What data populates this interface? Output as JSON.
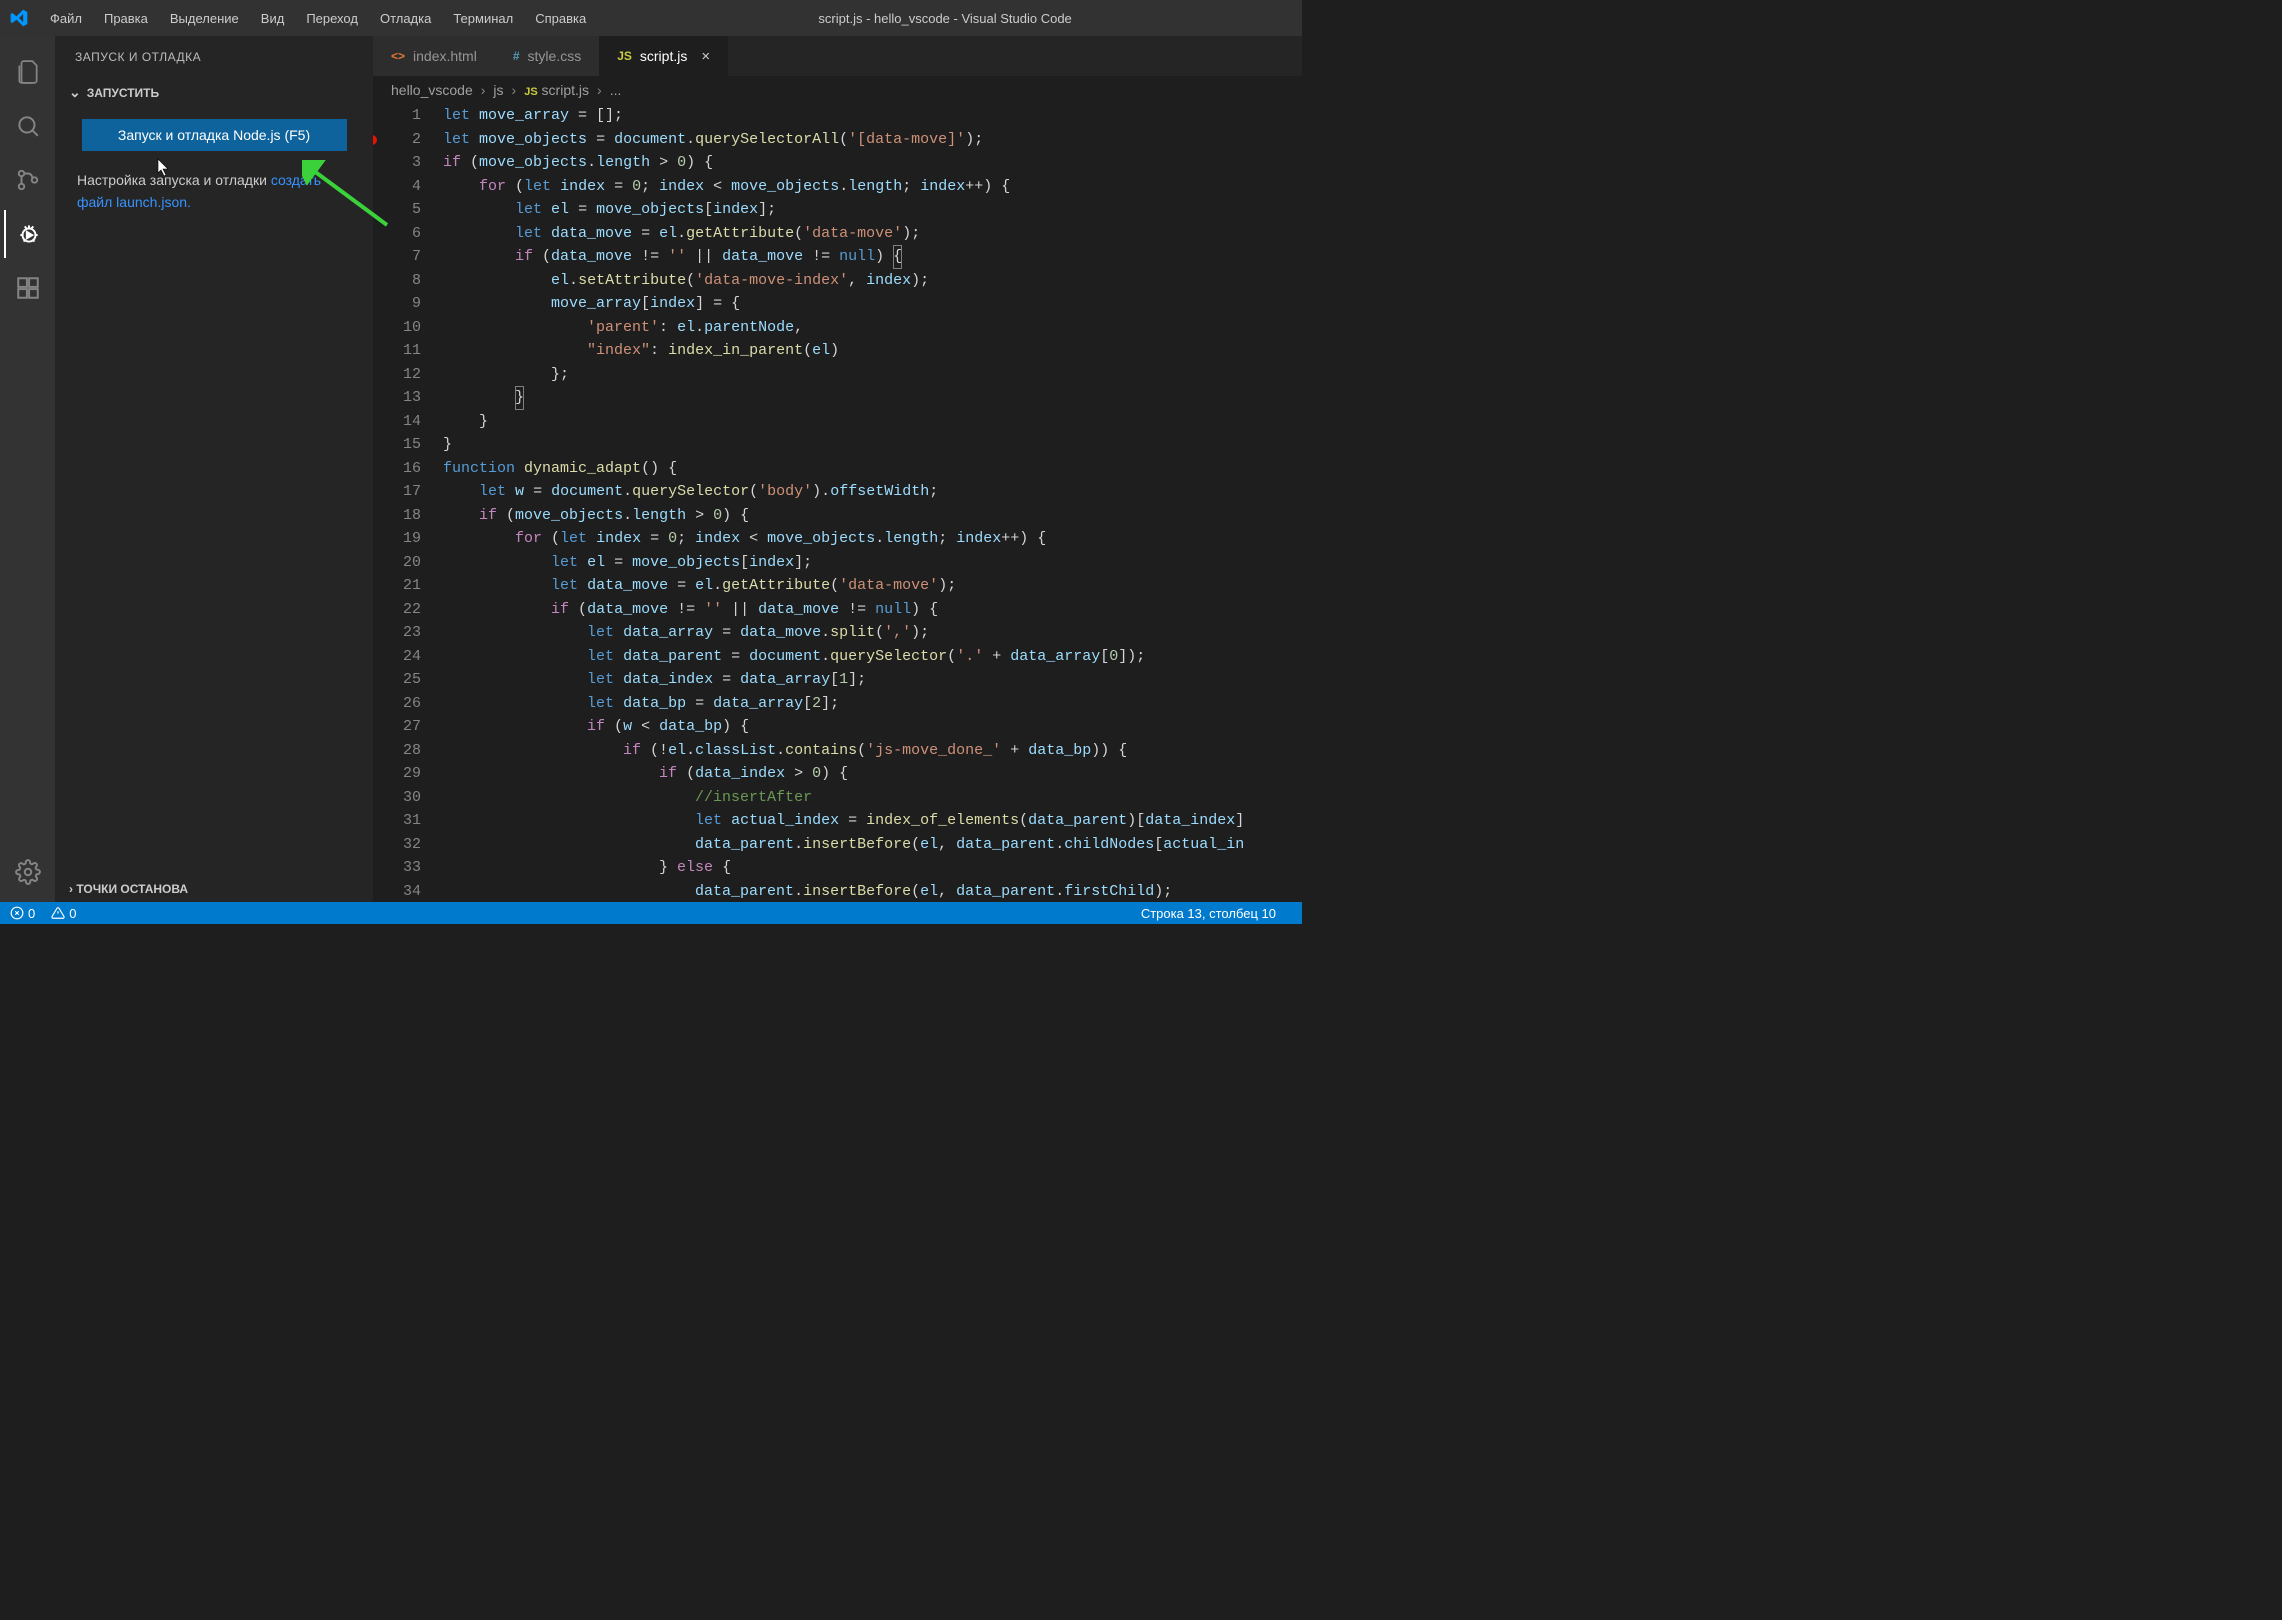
{
  "menubar": {
    "items": [
      "Файл",
      "Правка",
      "Выделение",
      "Вид",
      "Переход",
      "Отладка",
      "Терминал",
      "Справка"
    ],
    "title": "script.js - hello_vscode - Visual Studio Code"
  },
  "activity": {
    "items": [
      "files-icon",
      "search-icon",
      "source-control-icon",
      "debug-icon",
      "extensions-icon"
    ],
    "bottom": [
      "gear-icon"
    ],
    "active": 3
  },
  "sidebar": {
    "header": "ЗАПУСК И ОТЛАДКА",
    "section_run": "ЗАПУСТИТЬ",
    "run_button": "Запуск и отладка Node.js (F5)",
    "config_text": "Настройка запуска и отладки",
    "create_launch": "создать файл launch.json.",
    "breakpoints": "ТОЧКИ ОСТАНОВА"
  },
  "tabs": [
    {
      "icon_color": "#e37933",
      "prefix": "<>",
      "label": "index.html",
      "active": false
    },
    {
      "icon_color": "#519aba",
      "prefix": "#",
      "label": "style.css",
      "active": false
    },
    {
      "icon_color": "#cbcb41",
      "prefix": "JS",
      "label": "script.js",
      "active": true,
      "close": true
    }
  ],
  "breadcrumb": [
    "hello_vscode",
    "js",
    "script.js",
    "..."
  ],
  "breadcrumb_icon_idx": 2,
  "code": {
    "lines": [
      {
        "n": 1,
        "html": "<span class='k'>let</span> <span class='v'>move_array</span> = [];"
      },
      {
        "n": 2,
        "bp": true,
        "html": "<span class='k'>let</span> <span class='v'>move_objects</span> = <span class='v'>document</span>.<span class='fn'>querySelectorAll</span>(<span class='s'>'[data-move]'</span>);"
      },
      {
        "n": 3,
        "html": "<span class='kw'>if</span> (<span class='v'>move_objects</span>.<span class='v'>length</span> &gt; <span class='n'>0</span>) {"
      },
      {
        "n": 4,
        "html": "    <span class='kw'>for</span> (<span class='k'>let</span> <span class='v'>index</span> = <span class='n'>0</span>; <span class='v'>index</span> &lt; <span class='v'>move_objects</span>.<span class='v'>length</span>; <span class='v'>index</span>++) {"
      },
      {
        "n": 5,
        "html": "        <span class='k'>let</span> <span class='v'>el</span> = <span class='v'>move_objects</span>[<span class='v'>index</span>];"
      },
      {
        "n": 6,
        "html": "        <span class='k'>let</span> <span class='v'>data_move</span> = <span class='v'>el</span>.<span class='fn'>getAttribute</span>(<span class='s'>'data-move'</span>);"
      },
      {
        "n": 7,
        "html": "        <span class='kw'>if</span> (<span class='v'>data_move</span> != <span class='s'>''</span> || <span class='v'>data_move</span> != <span class='k'>null</span>) <span class='highlighted'>{</span>"
      },
      {
        "n": 8,
        "html": "            <span class='v'>el</span>.<span class='fn'>setAttribute</span>(<span class='s'>'data-move-index'</span>, <span class='v'>index</span>);"
      },
      {
        "n": 9,
        "html": "            <span class='v'>move_array</span>[<span class='v'>index</span>] = {"
      },
      {
        "n": 10,
        "html": "                <span class='s'>'parent'</span>: <span class='v'>el</span>.<span class='v'>parentNode</span>,"
      },
      {
        "n": 11,
        "html": "                <span class='s'>\"index\"</span>: <span class='fn'>index_in_parent</span>(<span class='v'>el</span>)"
      },
      {
        "n": 12,
        "html": "            };"
      },
      {
        "n": 13,
        "html": "        <span class='highlighted'>}</span>"
      },
      {
        "n": 14,
        "html": "    }"
      },
      {
        "n": 15,
        "html": "}"
      },
      {
        "n": 16,
        "html": "<span class='k'>function</span> <span class='fn'>dynamic_adapt</span>() {"
      },
      {
        "n": 17,
        "html": "    <span class='k'>let</span> <span class='v'>w</span> = <span class='v'>document</span>.<span class='fn'>querySelector</span>(<span class='s'>'body'</span>).<span class='v'>offsetWidth</span>;"
      },
      {
        "n": 18,
        "html": "    <span class='kw'>if</span> (<span class='v'>move_objects</span>.<span class='v'>length</span> &gt; <span class='n'>0</span>) {"
      },
      {
        "n": 19,
        "html": "        <span class='kw'>for</span> (<span class='k'>let</span> <span class='v'>index</span> = <span class='n'>0</span>; <span class='v'>index</span> &lt; <span class='v'>move_objects</span>.<span class='v'>length</span>; <span class='v'>index</span>++) {"
      },
      {
        "n": 20,
        "html": "            <span class='k'>let</span> <span class='v'>el</span> = <span class='v'>move_objects</span>[<span class='v'>index</span>];"
      },
      {
        "n": 21,
        "html": "            <span class='k'>let</span> <span class='v'>data_move</span> = <span class='v'>el</span>.<span class='fn'>getAttribute</span>(<span class='s'>'data-move'</span>);"
      },
      {
        "n": 22,
        "html": "            <span class='kw'>if</span> (<span class='v'>data_move</span> != <span class='s'>''</span> || <span class='v'>data_move</span> != <span class='k'>null</span>) {"
      },
      {
        "n": 23,
        "html": "                <span class='k'>let</span> <span class='v'>data_array</span> = <span class='v'>data_move</span>.<span class='fn'>split</span>(<span class='s'>','</span>);"
      },
      {
        "n": 24,
        "html": "                <span class='k'>let</span> <span class='v'>data_parent</span> = <span class='v'>document</span>.<span class='fn'>querySelector</span>(<span class='s'>'.'</span> + <span class='v'>data_array</span>[<span class='n'>0</span>]);"
      },
      {
        "n": 25,
        "html": "                <span class='k'>let</span> <span class='v'>data_index</span> = <span class='v'>data_array</span>[<span class='n'>1</span>];"
      },
      {
        "n": 26,
        "html": "                <span class='k'>let</span> <span class='v'>data_bp</span> = <span class='v'>data_array</span>[<span class='n'>2</span>];"
      },
      {
        "n": 27,
        "html": "                <span class='kw'>if</span> (<span class='v'>w</span> &lt; <span class='v'>data_bp</span>) {"
      },
      {
        "n": 28,
        "html": "                    <span class='kw'>if</span> (!<span class='v'>el</span>.<span class='v'>classList</span>.<span class='fn'>contains</span>(<span class='s'>'js-move_done_'</span> + <span class='v'>data_bp</span>)) {"
      },
      {
        "n": 29,
        "html": "                        <span class='kw'>if</span> (<span class='v'>data_index</span> &gt; <span class='n'>0</span>) {"
      },
      {
        "n": 30,
        "html": "                            <span class='c'>//insertAfter</span>"
      },
      {
        "n": 31,
        "html": "                            <span class='k'>let</span> <span class='v'>actual_index</span> = <span class='fn'>index_of_elements</span>(<span class='v'>data_parent</span>)[<span class='v'>data_index</span>]"
      },
      {
        "n": 32,
        "html": "                            <span class='v'>data_parent</span>.<span class='fn'>insertBefore</span>(<span class='v'>el</span>, <span class='v'>data_parent</span>.<span class='v'>childNodes</span>[<span class='v'>actual_in</span>"
      },
      {
        "n": 33,
        "html": "                        } <span class='kw'>else</span> {"
      },
      {
        "n": 34,
        "html": "                            <span class='v'>data_parent</span>.<span class='fn'>insertBefore</span>(<span class='v'>el</span>, <span class='v'>data_parent</span>.<span class='v'>firstChild</span>);"
      }
    ]
  },
  "statusbar": {
    "errors": "0",
    "warnings": "0",
    "cursor": "Строка 13, столбец 10"
  }
}
